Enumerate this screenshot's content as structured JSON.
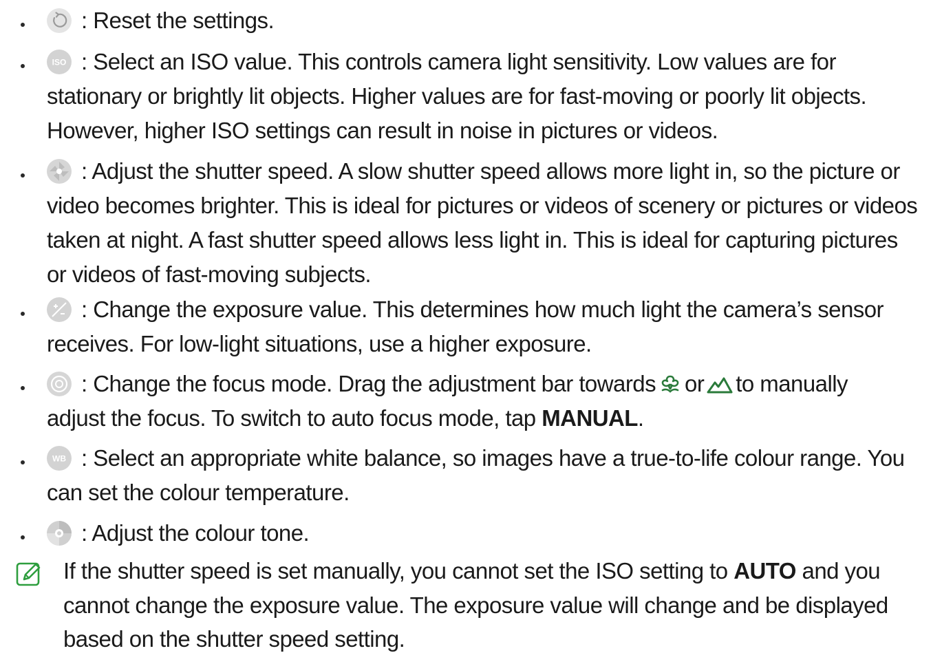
{
  "items": [
    {
      "icon": "reset-icon",
      "lines": [
        ": Reset the settings."
      ]
    },
    {
      "icon": "iso-icon",
      "icon_text": "ISO",
      "lines": [
        ": Select an ISO value. This controls camera light sensitivity. Low values are for",
        "stationary or brightly lit objects. Higher values are for fast-moving or poorly lit objects.",
        "However, higher ISO settings can result in noise in pictures or videos."
      ]
    },
    {
      "icon": "shutter-speed-icon",
      "lines": [
        ": Adjust the shutter speed. A slow shutter speed allows more light in, so the picture or",
        "video becomes brighter. This is ideal for pictures or videos of scenery or pictures or videos",
        "taken at night. A fast shutter speed allows less light in. This is ideal for capturing pictures",
        "or videos of fast-moving subjects."
      ]
    },
    {
      "icon": "exposure-icon",
      "lines": [
        ": Change the exposure value. This determines how much light the camera’s sensor",
        "receives. For low-light situations, use a higher exposure."
      ]
    },
    {
      "icon": "focus-mode-icon",
      "line1_a": ": Change the focus mode. Drag the adjustment bar towards",
      "line1_b": "or",
      "line1_c": "to manually",
      "line2_a": "adjust the focus. To switch to auto focus mode, tap",
      "line2_bold": "MANUAL",
      "line2_c": "."
    },
    {
      "icon": "white-balance-icon",
      "icon_text": "WB",
      "lines": [
        ": Select an appropriate white balance, so images have a true-to-life colour range. You",
        "can set the colour temperature."
      ]
    },
    {
      "icon": "colour-tone-icon",
      "lines": [
        ": Adjust the colour tone."
      ]
    }
  ],
  "note": {
    "icon": "note-icon",
    "line1_a": "If the shutter speed is set manually, you cannot set the ISO setting to",
    "line1_bold": "AUTO",
    "line1_c": "and you",
    "line2": "cannot change the exposure value. The exposure value will change and be displayed",
    "line3": "based on the shutter speed setting."
  }
}
